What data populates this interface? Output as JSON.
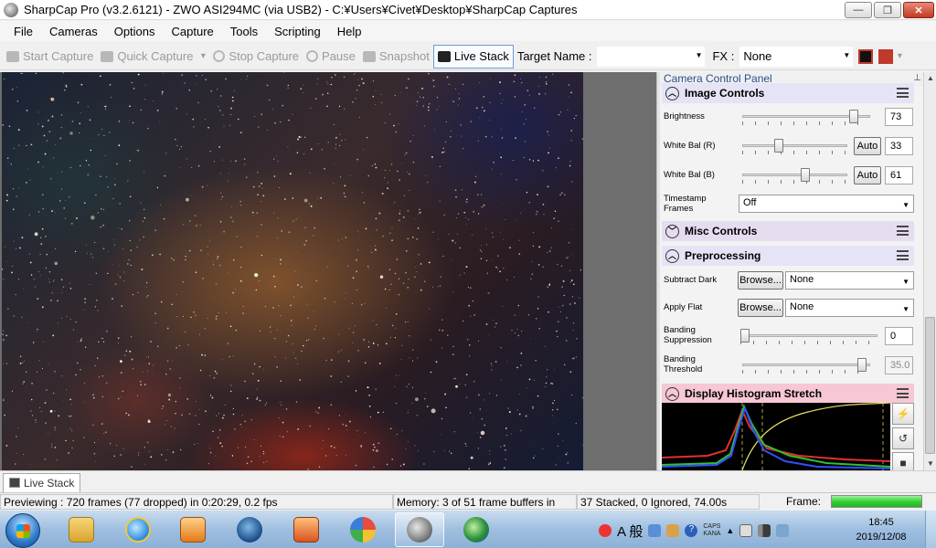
{
  "window": {
    "title": "SharpCap Pro (v3.2.6121) - ZWO ASI294MC (via USB2) - C:¥Users¥Civet¥Desktop¥SharpCap Captures",
    "minimize": "—",
    "maximize": "❐",
    "close": "✕"
  },
  "menu": [
    "File",
    "Cameras",
    "Options",
    "Capture",
    "Tools",
    "Scripting",
    "Help"
  ],
  "toolbar": {
    "start_capture": "Start Capture",
    "quick_capture": "Quick Capture",
    "stop_capture": "Stop Capture",
    "pause": "Pause",
    "snapshot": "Snapshot",
    "live_stack": "Live Stack",
    "target_name_label": "Target Name :",
    "target_name_value": "",
    "fx_label": "FX :",
    "fx_value": "None"
  },
  "panel": {
    "title": "Camera Control Panel",
    "image_controls": {
      "header": "Image Controls",
      "brightness_label": "Brightness",
      "brightness_value": "73",
      "brightness_level": 0.9,
      "wb_r_label": "White Bal (R)",
      "wb_r_value": "33",
      "wb_r_level": 0.33,
      "wb_r_auto": "Auto",
      "wb_b_label": "White Bal (B)",
      "wb_b_value": "61",
      "wb_b_level": 0.61,
      "wb_b_auto": "Auto",
      "timestamp_label_1": "Timestamp",
      "timestamp_label_2": "Frames",
      "timestamp_value": "Off"
    },
    "misc_controls": {
      "header": "Misc Controls"
    },
    "preprocessing": {
      "header": "Preprocessing",
      "subtract_dark_label": "Subtract Dark",
      "subtract_dark_browse": "Browse...",
      "subtract_dark_value": "None",
      "apply_flat_label": "Apply Flat",
      "apply_flat_browse": "Browse...",
      "apply_flat_value": "None",
      "banding_supp_label_1": "Banding",
      "banding_supp_label_2": "Suppression",
      "banding_supp_value": "0",
      "banding_supp_level": 0.0,
      "banding_thresh_label_1": "Banding",
      "banding_thresh_label_2": "Threshold",
      "banding_thresh_value": "35.0",
      "banding_thresh_level": 0.97
    },
    "histogram": {
      "header": "Display Histogram Stretch"
    }
  },
  "tabs": [
    "Live Stack"
  ],
  "status": {
    "previewing": "Previewing : 720 frames (77 dropped) in 0:20:29, 0.2 fps",
    "memory": "Memory: 3 of 51 frame buffers in",
    "stacked": "37 Stacked, 0 Ignored, 74.00s",
    "frame_label": "Frame:",
    "frame_progress": 1.0
  },
  "taskbar": {
    "ime": "A 般",
    "caps": "CAPS",
    "kana": "KANA",
    "time": "18:45",
    "date": "2019/12/08"
  },
  "colors": {
    "accent_blue": "#2a4f8a",
    "hist_red": "#e03030",
    "hist_green": "#30c030",
    "hist_blue": "#3050ff",
    "hist_curve": "#e8e060",
    "frame_green": "#2fcf2f"
  }
}
